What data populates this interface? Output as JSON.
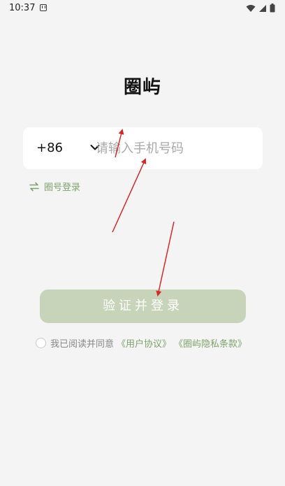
{
  "status_bar": {
    "time": "10:37",
    "icons": [
      "notification-a-icon",
      "wifi-icon",
      "signal-icon",
      "battery-icon"
    ]
  },
  "app": {
    "title": "圈屿"
  },
  "phone_login": {
    "country_code": "+86",
    "phone_placeholder": "请输入手机号码",
    "phone_value": ""
  },
  "switch_login": {
    "label": "圈号登录",
    "icon": "swap-arrows-icon"
  },
  "submit": {
    "label": "验证并登录"
  },
  "agreement": {
    "checked": false,
    "text": "我已阅读并同意",
    "user_agreement": "《用户协议》",
    "privacy_policy": "《圈屿隐私条款》"
  },
  "colors": {
    "background": "#f4f4f4",
    "accent": "#7fa36c",
    "button_disabled": "#c7d4b9",
    "annotation_arrow": "#d62828"
  }
}
